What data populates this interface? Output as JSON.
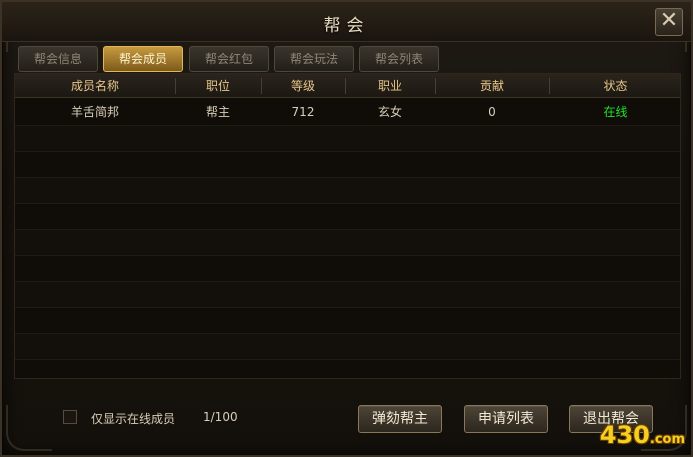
{
  "window": {
    "title": "帮会",
    "close_label": "✕"
  },
  "tabs": [
    {
      "label": "帮会信息",
      "active": false
    },
    {
      "label": "帮会成员",
      "active": true
    },
    {
      "label": "帮会红包",
      "active": false
    },
    {
      "label": "帮会玩法",
      "active": false
    },
    {
      "label": "帮会列表",
      "active": false
    }
  ],
  "table": {
    "headers": [
      "成员名称",
      "职位",
      "等级",
      "职业",
      "贡献",
      "状态"
    ],
    "rows": [
      {
        "name": "羊舌简邦",
        "position": "帮主",
        "level": "712",
        "class": "玄女",
        "contribution": "0",
        "status": "在线"
      }
    ]
  },
  "footer": {
    "filter_label": "仅显示在线成员",
    "filter_checked": false,
    "count": "1/100",
    "buttons": [
      "弹劾帮主",
      "申请列表",
      "退出帮会"
    ]
  },
  "watermark": {
    "main": "430",
    "suffix": ".com"
  },
  "colors": {
    "online": "#22e02a",
    "header_text": "#e6c68a",
    "tab_active": "#c69a3e"
  }
}
